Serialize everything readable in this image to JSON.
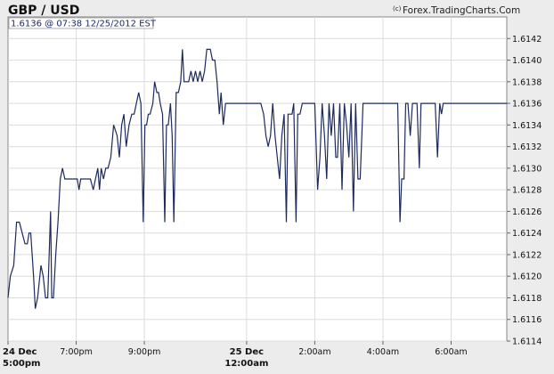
{
  "header": {
    "title": "GBP / USD",
    "source_symbol": "(c)",
    "source": "Forex.TradingCharts.Com",
    "stamp": "1.6136 @ 07:38  12/25/2012 EST"
  },
  "chart_data": {
    "type": "line",
    "title": "GBP / USD",
    "xlabel": "",
    "ylabel": "",
    "ylim": [
      1.6114,
      1.6144
    ],
    "grid": true,
    "y_ticks": [
      "1.6114",
      "1.6116",
      "1.6118",
      "1.6120",
      "1.6122",
      "1.6124",
      "1.6126",
      "1.6128",
      "1.6130",
      "1.6132",
      "1.6134",
      "1.6136",
      "1.6138",
      "1.6140",
      "1.6142"
    ],
    "x_ticks": [
      {
        "t": 0,
        "line1": "24 Dec",
        "line2": "5:00pm",
        "bold": true
      },
      {
        "t": 120,
        "line1": "7:00pm",
        "bold": false
      },
      {
        "t": 240,
        "line1": "9:00pm",
        "bold": false
      },
      {
        "t": 420,
        "line1": "25 Dec",
        "line2": "12:00am",
        "bold": true
      },
      {
        "t": 540,
        "line1": "2:00am",
        "bold": false
      },
      {
        "t": 660,
        "line1": "4:00am",
        "bold": false
      },
      {
        "t": 780,
        "line1": "6:00am",
        "bold": false
      }
    ],
    "x_max_minutes": 878,
    "series": [
      {
        "color": "#1c2a5c",
        "points": [
          [
            0,
            1.6118
          ],
          [
            4,
            1.612
          ],
          [
            10,
            1.6121
          ],
          [
            15,
            1.6125
          ],
          [
            20,
            1.6125
          ],
          [
            25,
            1.6124
          ],
          [
            30,
            1.6123
          ],
          [
            34,
            1.6123
          ],
          [
            37,
            1.6124
          ],
          [
            40,
            1.6124
          ],
          [
            45,
            1.612
          ],
          [
            48,
            1.6117
          ],
          [
            52,
            1.6118
          ],
          [
            58,
            1.6121
          ],
          [
            62,
            1.612
          ],
          [
            66,
            1.6118
          ],
          [
            70,
            1.6118
          ],
          [
            75,
            1.6126
          ],
          [
            77,
            1.6118
          ],
          [
            80,
            1.6118
          ],
          [
            84,
            1.6122
          ],
          [
            88,
            1.6125
          ],
          [
            92,
            1.6129
          ],
          [
            96,
            1.613
          ],
          [
            100,
            1.6129
          ],
          [
            106,
            1.6129
          ],
          [
            112,
            1.6129
          ],
          [
            118,
            1.6129
          ],
          [
            122,
            1.6129
          ],
          [
            125,
            1.6128
          ],
          [
            128,
            1.6129
          ],
          [
            134,
            1.6129
          ],
          [
            140,
            1.6129
          ],
          [
            145,
            1.6129
          ],
          [
            150,
            1.6128
          ],
          [
            154,
            1.6129
          ],
          [
            158,
            1.613
          ],
          [
            161,
            1.6128
          ],
          [
            164,
            1.613
          ],
          [
            168,
            1.6129
          ],
          [
            172,
            1.613
          ],
          [
            176,
            1.613
          ],
          [
            181,
            1.6131
          ],
          [
            186,
            1.6134
          ],
          [
            192,
            1.6133
          ],
          [
            196,
            1.6131
          ],
          [
            200,
            1.6134
          ],
          [
            204,
            1.6135
          ],
          [
            208,
            1.6132
          ],
          [
            213,
            1.6134
          ],
          [
            218,
            1.6135
          ],
          [
            222,
            1.6135
          ],
          [
            226,
            1.6136
          ],
          [
            230,
            1.6137
          ],
          [
            234,
            1.6136
          ],
          [
            238,
            1.6125
          ],
          [
            241,
            1.6134
          ],
          [
            244,
            1.6134
          ],
          [
            247,
            1.6135
          ],
          [
            250,
            1.6135
          ],
          [
            255,
            1.6136
          ],
          [
            258,
            1.6138
          ],
          [
            262,
            1.6137
          ],
          [
            265,
            1.6137
          ],
          [
            268,
            1.6136
          ],
          [
            272,
            1.6135
          ],
          [
            276,
            1.6125
          ],
          [
            279,
            1.6134
          ],
          [
            282,
            1.6134
          ],
          [
            286,
            1.6136
          ],
          [
            289,
            1.6133
          ],
          [
            292,
            1.6125
          ],
          [
            296,
            1.6137
          ],
          [
            300,
            1.6137
          ],
          [
            304,
            1.6138
          ],
          [
            307,
            1.6141
          ],
          [
            310,
            1.6138
          ],
          [
            313,
            1.6138
          ],
          [
            318,
            1.6138
          ],
          [
            322,
            1.6139
          ],
          [
            326,
            1.6138
          ],
          [
            330,
            1.6139
          ],
          [
            334,
            1.6138
          ],
          [
            338,
            1.6139
          ],
          [
            342,
            1.6138
          ],
          [
            346,
            1.6139
          ],
          [
            350,
            1.6141
          ],
          [
            356,
            1.6141
          ],
          [
            360,
            1.614
          ],
          [
            364,
            1.614
          ],
          [
            368,
            1.6138
          ],
          [
            372,
            1.6135
          ],
          [
            375,
            1.6137
          ],
          [
            379,
            1.6134
          ],
          [
            383,
            1.6136
          ],
          [
            388,
            1.6136
          ],
          [
            395,
            1.6136
          ],
          [
            405,
            1.6136
          ],
          [
            415,
            1.6136
          ],
          [
            425,
            1.6136
          ],
          [
            435,
            1.6136
          ],
          [
            445,
            1.6136
          ],
          [
            450,
            1.6135
          ],
          [
            454,
            1.6133
          ],
          [
            458,
            1.6132
          ],
          [
            462,
            1.6133
          ],
          [
            466,
            1.6136
          ],
          [
            470,
            1.6133
          ],
          [
            474,
            1.6131
          ],
          [
            478,
            1.6129
          ],
          [
            482,
            1.6133
          ],
          [
            486,
            1.6135
          ],
          [
            490,
            1.6125
          ],
          [
            493,
            1.6135
          ],
          [
            496,
            1.6135
          ],
          [
            500,
            1.6135
          ],
          [
            503,
            1.6136
          ],
          [
            507,
            1.6125
          ],
          [
            510,
            1.6135
          ],
          [
            514,
            1.6135
          ],
          [
            518,
            1.6136
          ],
          [
            522,
            1.6136
          ],
          [
            528,
            1.6136
          ],
          [
            534,
            1.6136
          ],
          [
            540,
            1.6136
          ],
          [
            545,
            1.6128
          ],
          [
            549,
            1.6131
          ],
          [
            553,
            1.6136
          ],
          [
            557,
            1.6133
          ],
          [
            561,
            1.6129
          ],
          [
            565,
            1.6136
          ],
          [
            569,
            1.6133
          ],
          [
            573,
            1.6136
          ],
          [
            577,
            1.6131
          ],
          [
            580,
            1.6131
          ],
          [
            584,
            1.6136
          ],
          [
            588,
            1.6128
          ],
          [
            592,
            1.6136
          ],
          [
            596,
            1.6134
          ],
          [
            600,
            1.6131
          ],
          [
            604,
            1.6136
          ],
          [
            608,
            1.6126
          ],
          [
            612,
            1.6136
          ],
          [
            616,
            1.6129
          ],
          [
            620,
            1.6129
          ],
          [
            625,
            1.6136
          ],
          [
            630,
            1.6136
          ],
          [
            640,
            1.6136
          ],
          [
            650,
            1.6136
          ],
          [
            660,
            1.6136
          ],
          [
            670,
            1.6136
          ],
          [
            680,
            1.6136
          ],
          [
            686,
            1.6136
          ],
          [
            690,
            1.6125
          ],
          [
            693,
            1.6129
          ],
          [
            697,
            1.6129
          ],
          [
            700,
            1.6136
          ],
          [
            704,
            1.6136
          ],
          [
            708,
            1.6133
          ],
          [
            712,
            1.6136
          ],
          [
            716,
            1.6136
          ],
          [
            720,
            1.6136
          ],
          [
            724,
            1.613
          ],
          [
            727,
            1.6136
          ],
          [
            732,
            1.6136
          ],
          [
            737,
            1.6136
          ],
          [
            742,
            1.6136
          ],
          [
            746,
            1.6136
          ],
          [
            752,
            1.6136
          ],
          [
            756,
            1.6131
          ],
          [
            760,
            1.6136
          ],
          [
            763,
            1.6135
          ],
          [
            766,
            1.6136
          ],
          [
            770,
            1.6136
          ],
          [
            774,
            1.6136
          ],
          [
            778,
            1.6136
          ],
          [
            782,
            1.6136
          ],
          [
            786,
            1.6136
          ],
          [
            790,
            1.6136
          ],
          [
            794,
            1.6136
          ],
          [
            798,
            1.6136
          ],
          [
            802,
            1.6136
          ],
          [
            806,
            1.6136
          ],
          [
            810,
            1.6136
          ],
          [
            814,
            1.6136
          ],
          [
            818,
            1.6136
          ],
          [
            822,
            1.6136
          ],
          [
            826,
            1.6136
          ],
          [
            830,
            1.6136
          ],
          [
            834,
            1.6136
          ],
          [
            838,
            1.6136
          ],
          [
            842,
            1.6136
          ],
          [
            846,
            1.6136
          ],
          [
            850,
            1.6136
          ],
          [
            854,
            1.6136
          ],
          [
            858,
            1.6136
          ],
          [
            862,
            1.6136
          ],
          [
            866,
            1.6136
          ],
          [
            870,
            1.6136
          ],
          [
            874,
            1.6136
          ],
          [
            878,
            1.6136
          ]
        ]
      }
    ]
  }
}
